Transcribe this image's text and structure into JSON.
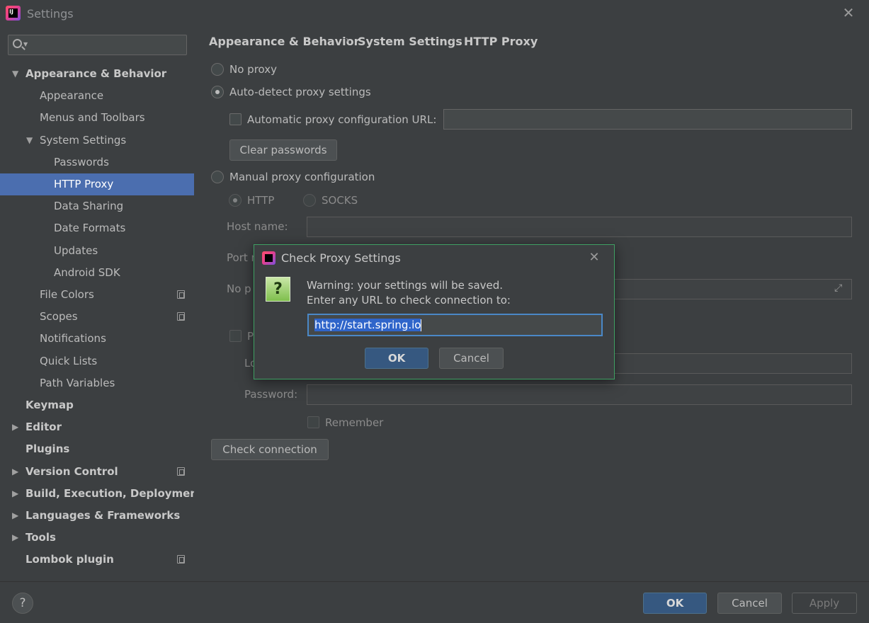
{
  "window": {
    "title": "Settings",
    "app_icon_text": "IJ"
  },
  "search": {
    "placeholder": ""
  },
  "sidebar": {
    "items": [
      {
        "label": "Appearance & Behavior",
        "level": 0,
        "bold": true,
        "arrow": "expanded"
      },
      {
        "label": "Appearance",
        "level": 1
      },
      {
        "label": "Menus and Toolbars",
        "level": 1
      },
      {
        "label": "System Settings",
        "level": 1,
        "arrow": "expanded"
      },
      {
        "label": "Passwords",
        "level": 2
      },
      {
        "label": "HTTP Proxy",
        "level": 2,
        "selected": true
      },
      {
        "label": "Data Sharing",
        "level": 2
      },
      {
        "label": "Date Formats",
        "level": 2
      },
      {
        "label": "Updates",
        "level": 2
      },
      {
        "label": "Android SDK",
        "level": 2
      },
      {
        "label": "File Colors",
        "level": 1,
        "project_icon": true
      },
      {
        "label": "Scopes",
        "level": 1,
        "project_icon": true
      },
      {
        "label": "Notifications",
        "level": 1
      },
      {
        "label": "Quick Lists",
        "level": 1
      },
      {
        "label": "Path Variables",
        "level": 1
      },
      {
        "label": "Keymap",
        "level": 0,
        "bold": true
      },
      {
        "label": "Editor",
        "level": 0,
        "bold": true,
        "arrow": "collapsed"
      },
      {
        "label": "Plugins",
        "level": 0,
        "bold": true
      },
      {
        "label": "Version Control",
        "level": 0,
        "bold": true,
        "arrow": "collapsed",
        "project_icon": true
      },
      {
        "label": "Build, Execution, Deployment",
        "level": 0,
        "bold": true,
        "arrow": "collapsed"
      },
      {
        "label": "Languages & Frameworks",
        "level": 0,
        "bold": true,
        "arrow": "collapsed"
      },
      {
        "label": "Tools",
        "level": 0,
        "bold": true,
        "arrow": "collapsed"
      },
      {
        "label": "Lombok plugin",
        "level": 0,
        "bold": true,
        "project_icon": true
      }
    ]
  },
  "breadcrumb": [
    "Appearance & Behavior",
    "System Settings",
    "HTTP Proxy"
  ],
  "breadcrumb_separator": "›",
  "proxy": {
    "no_proxy": "No proxy",
    "auto_detect": "Auto-detect proxy settings",
    "auto_config_url_label": "Automatic proxy configuration URL:",
    "auto_config_url_value": "",
    "clear_passwords": "Clear passwords",
    "manual": "Manual proxy configuration",
    "http": "HTTP",
    "socks": "SOCKS",
    "host_label": "Host name:",
    "port_label_partial": "Port n",
    "no_proxy_label_partial": "No p",
    "proxy_auth_partial": "P",
    "login_partial": "Lo",
    "password_label": "Password:",
    "remember": "Remember",
    "check_connection": "Check connection",
    "selected_mode": "auto_detect"
  },
  "footer": {
    "help": "?",
    "ok": "OK",
    "cancel": "Cancel",
    "apply": "Apply"
  },
  "dialog": {
    "title": "Check Proxy Settings",
    "icon_glyph": "?",
    "line1": "Warning: your settings will be saved.",
    "line2": "Enter any URL to check connection to:",
    "url": "http://start.spring.io",
    "ok": "OK",
    "cancel": "Cancel"
  },
  "colors": {
    "background": "#3c3f41",
    "selection": "#4b6eaf",
    "primary_button": "#365880",
    "dialog_border": "#3fa063",
    "focus_border": "#4a88c7"
  }
}
